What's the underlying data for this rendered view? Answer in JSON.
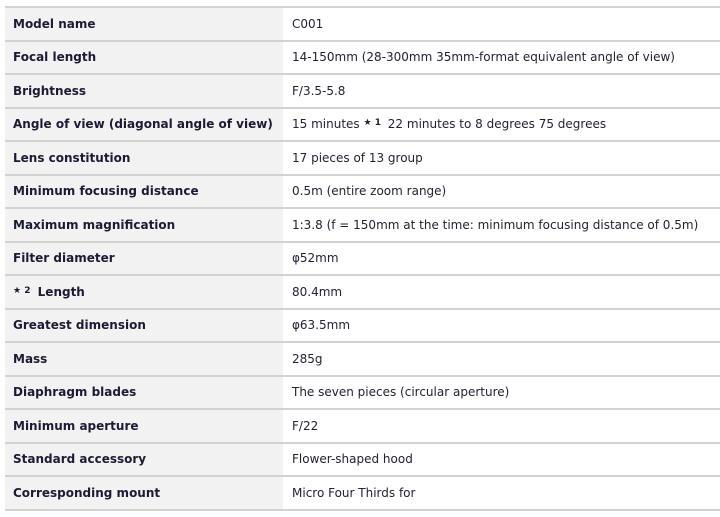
{
  "specs": {
    "rows": [
      {
        "label": "Model name",
        "value": "C001"
      },
      {
        "label": "Focal length",
        "value": "14-150mm (28-300mm 35mm-format equivalent angle of view)"
      },
      {
        "label": "Brightness",
        "value": "F/3.5-5.8"
      },
      {
        "label": "Angle of view (diagonal angle of view)",
        "value_before": "15 minutes",
        "value_note": "★ 1",
        "value_after": "22 minutes to 8 degrees 75 degrees"
      },
      {
        "label": "Lens constitution",
        "value": "17 pieces of 13 group"
      },
      {
        "label": "Minimum focusing distance",
        "value": "0.5m (entire zoom range)"
      },
      {
        "label": "Maximum magnification",
        "value": "1:3.8 (f = 150mm at the time: minimum focusing distance of 0.5m)"
      },
      {
        "label": "Filter diameter",
        "value": "φ52mm"
      },
      {
        "label_note": "★ 2",
        "label": "Length",
        "value": "80.4mm"
      },
      {
        "label": "Greatest dimension",
        "value": "φ63.5mm"
      },
      {
        "label": "Mass",
        "value": "285g"
      },
      {
        "label": "Diaphragm blades",
        "value": "The seven pieces (circular aperture)"
      },
      {
        "label": "Minimum aperture",
        "value": "F/22"
      },
      {
        "label": "Standard accessory",
        "value": "Flower-shaped hood"
      },
      {
        "label": "Corresponding mount",
        "value": "Micro Four Thirds for"
      }
    ]
  }
}
